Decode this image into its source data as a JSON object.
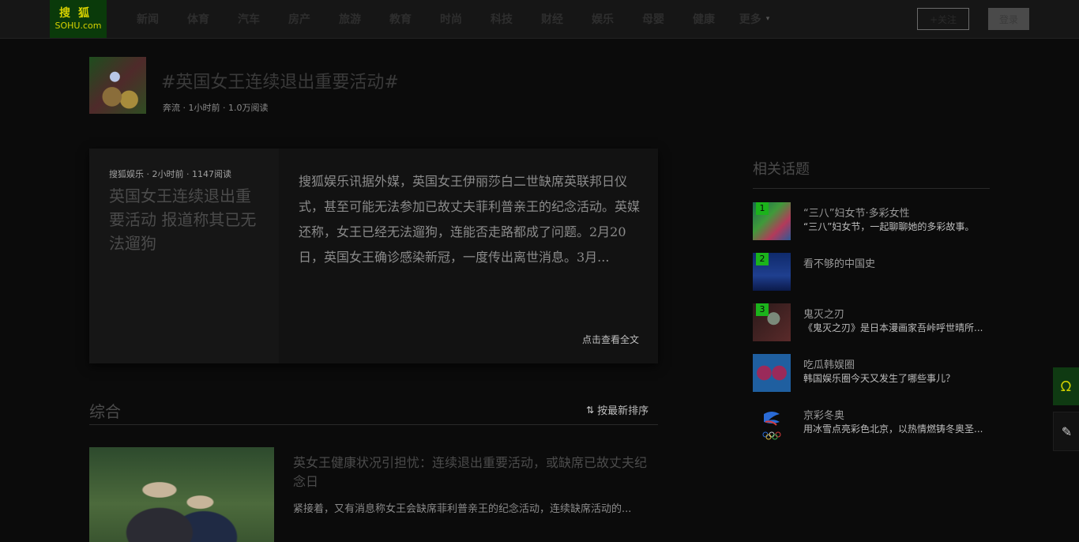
{
  "logo": {
    "cn": "搜狐",
    "en": "SOHU.com"
  },
  "nav": {
    "items": [
      "新闻",
      "体育",
      "汽车",
      "房产",
      "旅游",
      "教育",
      "时尚",
      "科技",
      "财经",
      "娱乐",
      "母婴",
      "健康"
    ],
    "more_label": "更多",
    "plus_button": "+关注",
    "login_button": "登录"
  },
  "topic": {
    "title": "#英国女王连续退出重要活动#",
    "meta": "奔流 · 1小时前 · 1.0万阅读"
  },
  "featured": {
    "meta": "搜狐娱乐 · 2小时前 · 1147阅读",
    "title": "英国女王连续退出重要活动 报道称其已无法遛狗",
    "body": "搜狐娱乐讯据外媒，英国女王伊丽莎白二世缺席英联邦日仪式，甚至可能无法参加已故丈夫菲利普亲王的纪念活动。英媒还称，女王已经无法遛狗，连能否走路都成了问题。2月20日，英国女王确诊感染新冠，一度传出离世消息。3月...",
    "read_more": "点击查看全文"
  },
  "section": {
    "title": "综合",
    "sort_label": "按最新排序"
  },
  "article": {
    "title": "英女王健康状况引担忧：连续退出重要活动，或缺席已故丈夫纪念日",
    "desc": "紧接着，又有消息称女王会缺席菲利普亲王的纪念活动，连续缺席活动的..."
  },
  "related": {
    "title": "相关话题",
    "items": [
      {
        "rank": "1",
        "name": "“三八”妇女节·多彩女性",
        "desc": "“三八”妇女节，一起聊聊她的多彩故事。"
      },
      {
        "rank": "2",
        "name": "看不够的中国史",
        "desc": ""
      },
      {
        "rank": "3",
        "name": "鬼灭之刃",
        "desc": "《鬼灭之刃》是日本漫画家吾峠呼世晴所..."
      },
      {
        "rank": "",
        "name": "吃瓜韩娱圈",
        "desc": "韩国娱乐圈今天又发生了哪些事儿？"
      },
      {
        "rank": "",
        "name": "京彩冬奥",
        "desc": "用冰雪点亮彩色北京，以热情燃铸冬奥圣..."
      }
    ]
  },
  "icons": {
    "sort": "sort-arrows-icon",
    "chevron": "chevron-down-icon",
    "float1": "sohu-fox-icon",
    "float2": "edit-pen-icon"
  }
}
